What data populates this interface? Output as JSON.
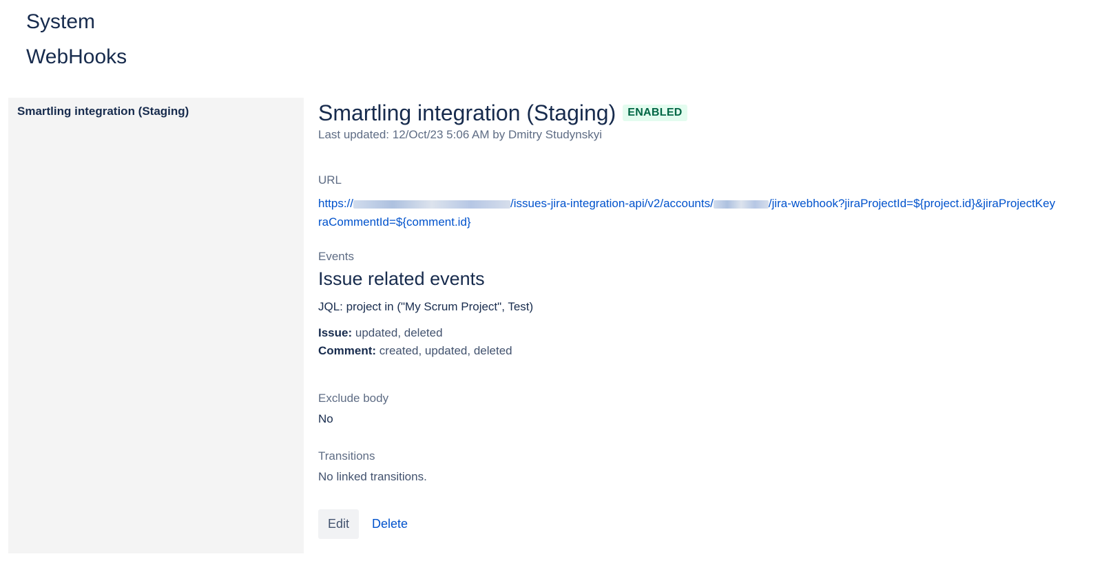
{
  "header": {
    "breadcrumb_1": "System",
    "breadcrumb_2": "WebHooks"
  },
  "sidebar": {
    "items": [
      {
        "label": "Smartling integration (Staging)"
      }
    ]
  },
  "webhook": {
    "name": "Smartling integration (Staging)",
    "status": "ENABLED",
    "last_updated": "Last updated: 12/Oct/23 5:06 AM by Dmitry Studynskyi",
    "url_label": "URL",
    "url_prefix": "https://",
    "url_part_2": "/issues-jira-integration-api/v2/accounts/",
    "url_part_3": "/jira-webhook?jiraProjectId=${project.id}&jiraProjectKey",
    "url_line_2": "raCommentId=${comment.id}",
    "events_label": "Events",
    "events_heading": "Issue related events",
    "jql_key": "JQL:",
    "jql_value": " project in (\"My Scrum Project\", Test)",
    "issue_key": "Issue:",
    "issue_value": " updated, deleted",
    "comment_key": "Comment:",
    "comment_value": " created, updated, deleted",
    "exclude_label": "Exclude body",
    "exclude_value": "No",
    "transitions_label": "Transitions",
    "transitions_value": "No linked transitions."
  },
  "actions": {
    "edit_label": "Edit",
    "delete_label": "Delete"
  },
  "colors": {
    "badge_bg": "#e3fcef",
    "badge_text": "#006644",
    "link": "#0052cc",
    "sidebar_bg": "#f4f4f4"
  }
}
